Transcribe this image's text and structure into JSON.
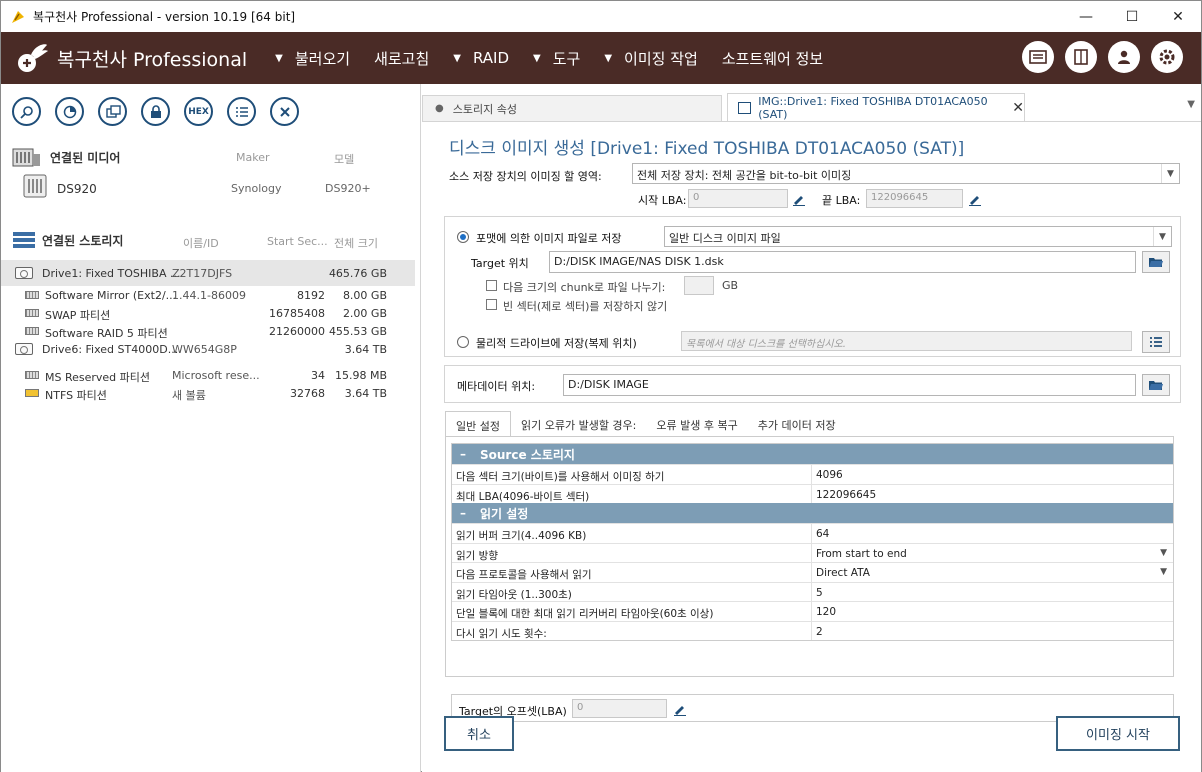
{
  "window": {
    "title": "복구천사 Professional - version 10.19 [64 bit]"
  },
  "menubar": {
    "brand": "복구천사 Professional",
    "items": [
      {
        "label": "불러오기",
        "arrow": true
      },
      {
        "label": "새로고침",
        "arrow": false
      },
      {
        "label": "RAID",
        "arrow": true
      },
      {
        "label": "도구",
        "arrow": true
      },
      {
        "label": "이미징 작업",
        "arrow": true
      },
      {
        "label": "소프트웨어 정보",
        "arrow": false
      }
    ]
  },
  "toolbar": {
    "hex_label": "HEX"
  },
  "media": {
    "heading": "연결된 미디어",
    "col_maker": "Maker",
    "col_model": "모델",
    "items": [
      {
        "name": "DS920",
        "maker": "Synology",
        "model": "DS920+"
      }
    ]
  },
  "storage": {
    "heading": "연결된 스토리지",
    "col_name": "이름/ID",
    "col_start": "Start Sec...",
    "col_size": "전체 크기",
    "rows": [
      {
        "name": "Drive1: Fixed TOSHIBA ...",
        "id": "Z2T17DJFS",
        "start": "",
        "size": "465.76 GB",
        "kind": "drive"
      },
      {
        "name": "Software Mirror (Ext2/...",
        "id": "1.44.1-86009",
        "start": "8192",
        "size": "8.00 GB",
        "kind": "part"
      },
      {
        "name": "SWAP 파티션",
        "id": "",
        "start": "16785408",
        "size": "2.00 GB",
        "kind": "part"
      },
      {
        "name": "Software RAID 5 파티션",
        "id": "",
        "start": "21260000",
        "size": "455.53 GB",
        "kind": "part"
      },
      {
        "name": "Drive6: Fixed ST4000D...",
        "id": "WW654G8P",
        "start": "",
        "size": "3.64 TB",
        "kind": "drive"
      },
      {
        "name": "MS Reserved 파티션",
        "id": "Microsoft rese...",
        "start": "34",
        "size": "15.98 MB",
        "kind": "part"
      },
      {
        "name": "NTFS 파티션",
        "id": "새 볼륨",
        "start": "32768",
        "size": "3.64 TB",
        "kind": "part-y"
      }
    ]
  },
  "tabs": {
    "tab1": "스토리지 속성",
    "tab2": "IMG::Drive1: Fixed TOSHIBA DT01ACA050 (SAT)"
  },
  "form": {
    "heading": "디스크 이미지 생성 [Drive1: Fixed TOSHIBA DT01ACA050 (SAT)]",
    "area_label": "소스 저장 장치의 이미징 할 영역:",
    "area_value": "전체 저장 장치: 전체 공간을 bit-to-bit 이미징",
    "start_lba_label": "시작 LBA:",
    "start_lba": "0",
    "end_lba_label": "끝 LBA:",
    "end_lba": "122096645",
    "save_file_label": "포맷에 의한 이미지 파일로 저장",
    "format_value": "일반 디스크 이미지 파일",
    "target_label": "Target 위치",
    "target_value": "D:/DISK IMAGE/NAS DISK 1.dsk",
    "chunk_label": "다음 크기의 chunk로 파일 나누기:",
    "chunk_unit": "GB",
    "skip_empty_label": "빈 섹터(제로 섹터)를 저장하지 않기",
    "physical_label": "물리적 드라이브에 저장(복제 위치)",
    "physical_placeholder": "목록에서 대상 디스크를 선택하십시오.",
    "meta_label": "메타데이터 위치:",
    "meta_value": "D:/DISK IMAGE"
  },
  "subtabs": [
    "일반 설정",
    "읽기 오류가 발생할 경우:",
    "오류 발생 후 복구",
    "추가 데이터 저장"
  ],
  "grid": {
    "cat1": "Source 스토리지",
    "rows1": [
      {
        "k": "다음 섹터 크기(바이트)를 사용해서 이미징 하기",
        "v": "4096",
        "dd": false
      },
      {
        "k": "최대 LBA(4096-바이트 섹터)",
        "v": "122096645",
        "dd": false
      }
    ],
    "cat2": "읽기 설정",
    "rows2": [
      {
        "k": "읽기 버퍼 크기(4..4096 KB)",
        "v": "64",
        "dd": false
      },
      {
        "k": "읽기 방향",
        "v": "From start to end",
        "dd": true
      },
      {
        "k": "다음 프로토콜을 사용해서 읽기",
        "v": "Direct ATA",
        "dd": true
      },
      {
        "k": "읽기 타임아웃 (1..300초)",
        "v": "5",
        "dd": false
      },
      {
        "k": "단일 블록에 대한 최대 읽기 리커버리 타임아웃(60초 이상)",
        "v": "120",
        "dd": false
      },
      {
        "k": "다시 읽기 시도 횟수:",
        "v": "2",
        "dd": false
      }
    ]
  },
  "offset": {
    "label": "Target의 오프셋(LBA)",
    "value": "0"
  },
  "buttons": {
    "cancel": "취소",
    "start": "이미징 시작"
  }
}
